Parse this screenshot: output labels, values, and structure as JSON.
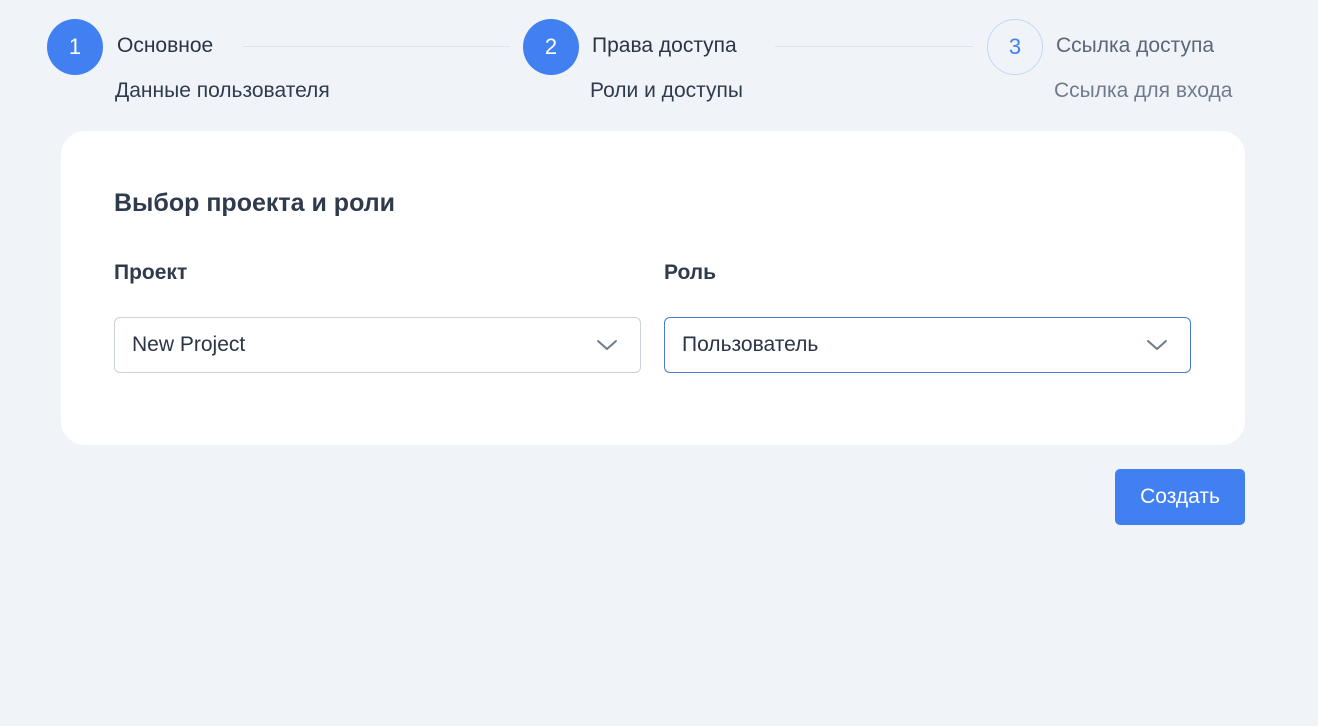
{
  "stepper": {
    "steps": [
      {
        "number": "1",
        "title": "Основное",
        "subtitle": "Данные пользователя",
        "state": "active"
      },
      {
        "number": "2",
        "title": "Права доступа",
        "subtitle": "Роли и доступы",
        "state": "active"
      },
      {
        "number": "3",
        "title": "Ссылка доступа",
        "subtitle": "Ссылка для входа",
        "state": "pending"
      }
    ]
  },
  "form": {
    "title": "Выбор проекта и роли",
    "project": {
      "label": "Проект",
      "value": "New Project"
    },
    "role": {
      "label": "Роль",
      "value": "Пользователь"
    }
  },
  "actions": {
    "create_label": "Создать"
  },
  "colors": {
    "accent": "#4080f0",
    "background": "#f0f4f9",
    "text": "#2f3a4c"
  }
}
